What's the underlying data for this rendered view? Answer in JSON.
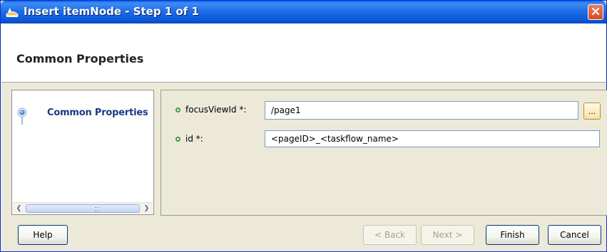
{
  "window": {
    "title": "Insert itemNode - Step 1 of 1"
  },
  "header": {
    "title": "Common Properties"
  },
  "nav": {
    "items": [
      {
        "label": "Common Properties",
        "icon": "step-dot-icon",
        "selected": true
      }
    ]
  },
  "form": {
    "fields": [
      {
        "label": "focusViewId *:",
        "value": "/page1",
        "required": true,
        "has_browse": true,
        "browse_label": "..."
      },
      {
        "label": "id *:",
        "value": "<pageID>_<taskflow_name>",
        "required": true
      }
    ]
  },
  "buttons": {
    "help": "Help",
    "back": "< Back",
    "next": "Next >",
    "finish": "Finish",
    "cancel": "Cancel"
  },
  "colors": {
    "title_bar": "#0b57d6",
    "dialog_bg": "#ece9d8",
    "required_marker": "#3e9a3e",
    "nav_label": "#1c3a83"
  }
}
